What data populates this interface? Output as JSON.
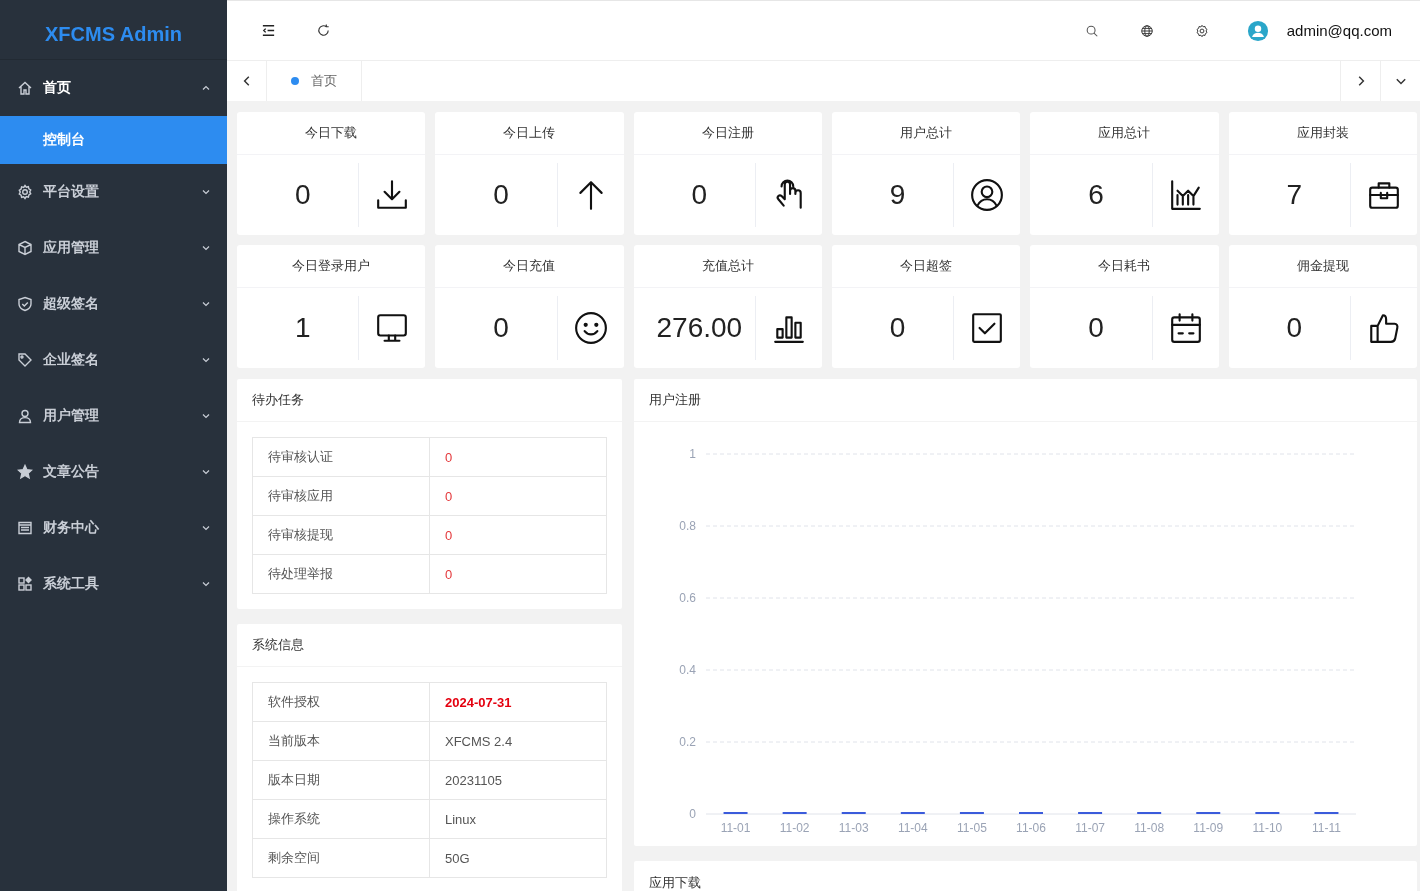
{
  "sidebar": {
    "logo": "XFCMS Admin",
    "items": [
      {
        "label": "首页",
        "expanded": true,
        "children": [
          {
            "label": "控制台",
            "selected": true
          }
        ]
      },
      {
        "label": "平台设置",
        "expanded": false
      },
      {
        "label": "应用管理",
        "expanded": false
      },
      {
        "label": "超级签名",
        "expanded": false
      },
      {
        "label": "企业签名",
        "expanded": false
      },
      {
        "label": "用户管理",
        "expanded": false
      },
      {
        "label": "文章公告",
        "expanded": false
      },
      {
        "label": "财务中心",
        "expanded": false
      },
      {
        "label": "系统工具",
        "expanded": false
      }
    ]
  },
  "header": {
    "user": "admin@qq.com"
  },
  "tabs": [
    {
      "label": "首页",
      "selected": true
    }
  ],
  "stats": [
    {
      "title": "今日下载",
      "value": "0"
    },
    {
      "title": "今日上传",
      "value": "0"
    },
    {
      "title": "今日注册",
      "value": "0"
    },
    {
      "title": "用户总计",
      "value": "9"
    },
    {
      "title": "应用总计",
      "value": "6"
    },
    {
      "title": "应用封装",
      "value": "7"
    },
    {
      "title": "今日登录用户",
      "value": "1"
    },
    {
      "title": "今日充值",
      "value": "0"
    },
    {
      "title": "充值总计",
      "value": "276.00"
    },
    {
      "title": "今日超签",
      "value": "0"
    },
    {
      "title": "今日耗书",
      "value": "0"
    },
    {
      "title": "佣金提现",
      "value": "0"
    }
  ],
  "tasks": {
    "title": "待办任务",
    "rows": [
      {
        "label": "待审核认证",
        "value": "0"
      },
      {
        "label": "待审核应用",
        "value": "0"
      },
      {
        "label": "待审核提现",
        "value": "0"
      },
      {
        "label": "待处理举报",
        "value": "0"
      }
    ]
  },
  "system_info": {
    "title": "系统信息",
    "rows": [
      {
        "label": "软件授权",
        "value": "2024-07-31",
        "highlight": true
      },
      {
        "label": "当前版本",
        "value": "XFCMS 2.4",
        "highlight": false
      },
      {
        "label": "版本日期",
        "value": "20231105",
        "highlight": false
      },
      {
        "label": "操作系统",
        "value": "Linux",
        "highlight": false
      },
      {
        "label": "剩余空间",
        "value": "50G",
        "highlight": false
      }
    ]
  },
  "registrations": {
    "title": "用户注册",
    "chart_data": {
      "type": "bar",
      "categories": [
        "11-01",
        "11-02",
        "11-03",
        "11-04",
        "11-05",
        "11-06",
        "11-07",
        "11-08",
        "11-09",
        "11-10",
        "11-11"
      ],
      "series": [
        {
          "color": "#3b5bdb",
          "values": [
            0,
            0,
            0,
            0,
            0,
            0,
            0,
            0,
            0,
            0,
            0
          ]
        }
      ],
      "ylim": [
        0,
        1
      ],
      "grid": true,
      "yticks": [
        0,
        0.2,
        0.4,
        0.6,
        0.8,
        1
      ]
    }
  },
  "downloads": {
    "title": "应用下载"
  }
}
